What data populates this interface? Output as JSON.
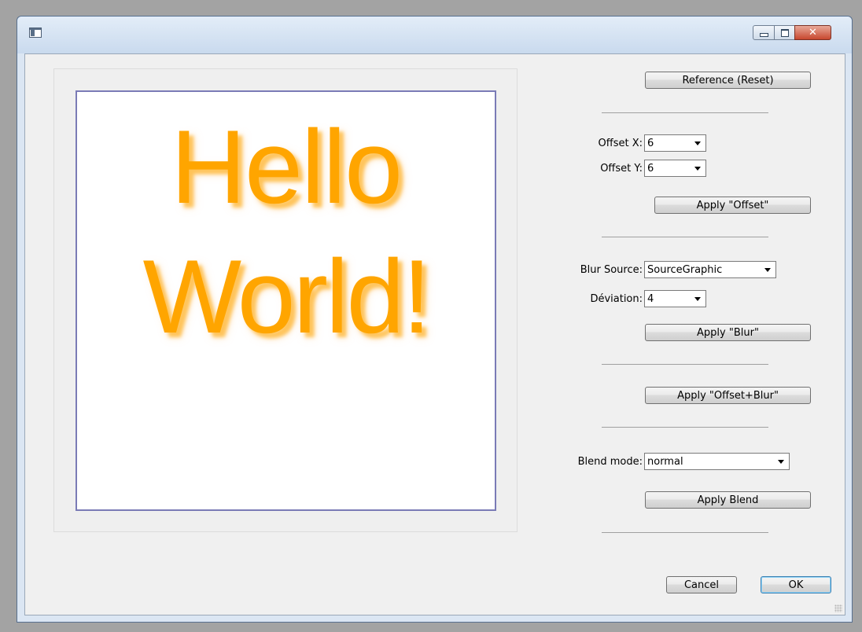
{
  "window": {
    "title": ""
  },
  "preview": {
    "line1": "Hello",
    "line2": "World!",
    "text_color": "#ffa500"
  },
  "controls": {
    "reference_button": "Reference (Reset)",
    "offset_x_label": "Offset X:",
    "offset_x_value": "6",
    "offset_y_label": "Offset Y:",
    "offset_y_value": "6",
    "apply_offset_button": "Apply \"Offset\"",
    "blur_source_label": "Blur Source:",
    "blur_source_value": "SourceGraphic",
    "deviation_label": "Déviation:",
    "deviation_value": "4",
    "apply_blur_button": "Apply \"Blur\"",
    "apply_offset_blur_button": "Apply \"Offset+Blur\"",
    "blend_mode_label": "Blend mode:",
    "blend_mode_value": "normal",
    "apply_blend_button": "Apply Blend"
  },
  "footer": {
    "cancel_button": "Cancel",
    "ok_button": "OK"
  },
  "icons": [
    "app-icon",
    "minimize-icon",
    "maximize-icon",
    "close-icon",
    "dropdown-arrow-icon",
    "resize-grip-icon"
  ]
}
